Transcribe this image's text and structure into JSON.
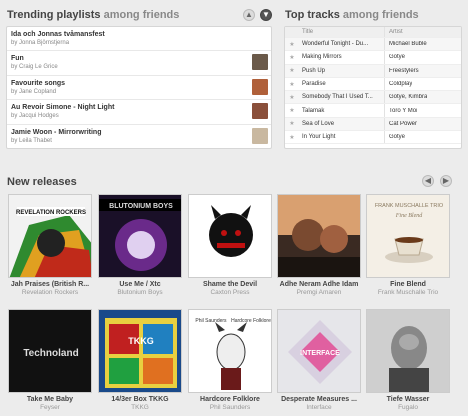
{
  "playlists_section": {
    "title": "Trending playlists",
    "subtitle": "among friends",
    "items": [
      {
        "name": "Ida och Jonnas tvåmansfest",
        "by": "by Jonna Björnstjerna",
        "thumb_color": "#ffffff"
      },
      {
        "name": "Fun",
        "by": "by Craig Le Grice",
        "thumb_color": "#6b5a4a"
      },
      {
        "name": "Favourite songs",
        "by": "by Jane Copland",
        "thumb_color": "#b0603a"
      },
      {
        "name": "Au Revoir Simone - Night Light",
        "by": "by Jacqui Hodges",
        "thumb_color": "#8a4f3a"
      },
      {
        "name": "Jamie Woon - Mirrorwriting",
        "by": "by Leila Thabet",
        "thumb_color": "#c9b8a0"
      }
    ]
  },
  "tracks_section": {
    "title": "Top tracks",
    "subtitle": "among friends",
    "col_title": "Title",
    "col_artist": "Artist",
    "rows": [
      {
        "title": "Wonderful Tonight - Du...",
        "artist": "Michael Bublé"
      },
      {
        "title": "Making Mirrors",
        "artist": "Gotye"
      },
      {
        "title": "Push Up",
        "artist": "Freestylers"
      },
      {
        "title": "Paradise",
        "artist": "Coldplay"
      },
      {
        "title": "Somebody That I Used T...",
        "artist": "Gotye, Kimbra"
      },
      {
        "title": "Talamak",
        "artist": "Toro Y Moi"
      },
      {
        "title": "Sea of Love",
        "artist": "Cat Power"
      },
      {
        "title": "In Your Light",
        "artist": "Gotye"
      }
    ]
  },
  "releases_section": {
    "title": "New releases",
    "albums": [
      {
        "title": "Jah Praises (British R...",
        "artist": "Revelation Rockers",
        "cover_text": "REVELATION ROCKERS"
      },
      {
        "title": "Use Me / Xtc",
        "artist": "Blutonium Boys",
        "cover_text": "BLUTONIUM BOYS"
      },
      {
        "title": "Shame the Devil",
        "artist": "Caxton Press",
        "cover_text": ""
      },
      {
        "title": "Adhe Neram Adhe Idam",
        "artist": "Premgi Amaren",
        "cover_text": ""
      },
      {
        "title": "Fine Blend",
        "artist": "Frank Muschalle Trio",
        "cover_text": "FRANK MUSCHALLE TRIO"
      },
      {
        "title": "Take Me Baby",
        "artist": "Feyser",
        "cover_text": "Technoland"
      },
      {
        "title": "14/3er Box TKKG",
        "artist": "TKKG",
        "cover_text": "TKKG"
      },
      {
        "title": "Hardcore Folklore",
        "artist": "Phil Saunders",
        "cover_text": "Hardcore Folklore"
      },
      {
        "title": "Desperate Measures ...",
        "artist": "Interface",
        "cover_text": "INTERFACE"
      },
      {
        "title": "Tiefe Wasser",
        "artist": "Fugalo",
        "cover_text": ""
      }
    ]
  }
}
